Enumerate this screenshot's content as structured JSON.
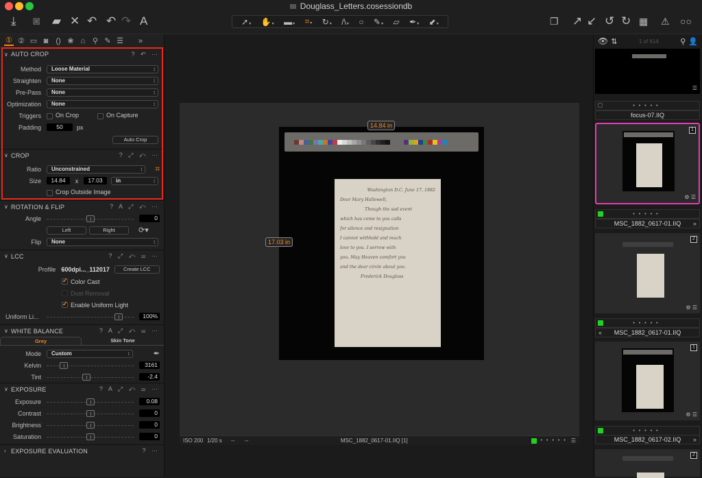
{
  "window": {
    "title": "Douglass_Letters.cosessiondb",
    "traffic_lights": [
      "#fe5f57",
      "#febc2e",
      "#28c840"
    ]
  },
  "toolbar": {
    "left_icons": [
      "import-icon",
      "camera-icon",
      "folder-move-icon",
      "delete-icon",
      "reset-icon",
      "undo-icon",
      "redo-icon",
      "text-icon"
    ],
    "cursor_tools": [
      "select-icon",
      "pan-icon",
      "loupe-icon",
      "crop-icon",
      "rotate-icon",
      "keystone-icon",
      "spot-icon",
      "brush-icon",
      "ruler-icon",
      "picker-icon",
      "annotate-icon"
    ],
    "active_cursor_tool": "crop-icon",
    "right_icons": [
      "multi-view-icon",
      "copy-adjust-icon",
      "apply-adjust-icon",
      "rotate-left-icon",
      "rotate-right-icon",
      "grid-icon",
      "warning-icon",
      "proof-glasses-icon"
    ]
  },
  "tool_tabs": [
    "1",
    "2",
    "folder",
    "camera",
    "lens",
    "color",
    "exposure",
    "details",
    "adjust",
    "metadata",
    "more"
  ],
  "auto_crop": {
    "title": "AUTO CROP",
    "method_label": "Method",
    "method_value": "Loose Material",
    "straighten_label": "Straighten",
    "straighten_value": "None",
    "prepass_label": "Pre-Pass",
    "prepass_value": "None",
    "optimization_label": "Optimization",
    "optimization_value": "None",
    "triggers_label": "Triggers",
    "on_crop_label": "On Crop",
    "on_crop_checked": false,
    "on_capture_label": "On Capture",
    "on_capture_checked": false,
    "padding_label": "Padding",
    "padding_value": "50",
    "padding_unit": "px",
    "button_label": "Auto Crop"
  },
  "crop": {
    "title": "CROP",
    "ratio_label": "Ratio",
    "ratio_value": "Unconstrained",
    "size_label": "Size",
    "width": "14.84",
    "x": "x",
    "height": "17.03",
    "unit": "in",
    "crop_outside_label": "Crop Outside Image",
    "crop_outside_checked": false
  },
  "rotation": {
    "title": "ROTATION & FLIP",
    "angle_label": "Angle",
    "angle_value": "0",
    "angle_slider": 0.5,
    "left_label": "Left",
    "right_label": "Right",
    "flip_label": "Flip",
    "flip_value": "None"
  },
  "lcc": {
    "title": "LCC",
    "profile_label": "Profile",
    "profile_value": "600dpi..._112017",
    "create_label": "Create LCC",
    "color_cast_label": "Color Cast",
    "color_cast_checked": true,
    "dust_label": "Dust Removal",
    "dust_checked": false,
    "uniform_label": "Enable Uniform Light",
    "uniform_checked": true,
    "uniform_slider_label": "Uniform Li...",
    "uniform_slider_value": "100%",
    "uniform_slider": 0.83
  },
  "white_balance": {
    "title": "WHITE BALANCE",
    "tab_grey": "Grey",
    "tab_skin": "Skin Tone",
    "mode_label": "Mode",
    "mode_value": "Custom",
    "kelvin_label": "Kelvin",
    "kelvin_value": "3161",
    "kelvin_slider": 0.2,
    "tint_label": "Tint",
    "tint_value": "-2.4",
    "tint_slider": 0.46
  },
  "exposure": {
    "title": "EXPOSURE",
    "sliders": [
      {
        "label": "Exposure",
        "value": "0.08",
        "pos": 0.5
      },
      {
        "label": "Contrast",
        "value": "0",
        "pos": 0.5
      },
      {
        "label": "Brightness",
        "value": "0",
        "pos": 0.5
      },
      {
        "label": "Saturation",
        "value": "0",
        "pos": 0.5
      }
    ]
  },
  "exposure_evaluation": {
    "title": "EXPOSURE EVALUATION"
  },
  "viewer": {
    "crop_width_label": "14.84 in",
    "crop_height_label": "17.03 in",
    "letter_lines": [
      "Washington D.C. June 17, 1882",
      "Dear Mary Hallowell,",
      "Though the sad event",
      "which has come to you calls",
      "for silence and resignation",
      "I cannot withhold and much",
      "love to you. I sorrow with",
      "you. May Heaven comfort you",
      "and the dear circle about you.",
      "Frederick Douglass"
    ],
    "color_chart": [
      "#6b3a30",
      "#c08a80",
      "#4b5ca0",
      "#3f7a3f",
      "#8a6ab0",
      "#3ab0a8",
      "#d4701c",
      "#3a48a0",
      "#c03a48",
      "#f0f0f0",
      "#d8d8d8",
      "#c0c0c0",
      "#a8a8a8",
      "#909090",
      "#787878",
      "#606060",
      "#484848",
      "#303030",
      "#202020",
      "#151515",
      "#5a2e80",
      "#8ab83a",
      "#e0a018",
      "#283c90",
      "#3a8a3a",
      "#b02830",
      "#e0c818",
      "#b83890",
      "#1a88b8"
    ]
  },
  "statusbar": {
    "iso": "ISO 200",
    "shutter": "1/20 s",
    "aperture": "--",
    "focal": "--",
    "filename": "MSC_1882_0617-01.IIQ [1]"
  },
  "browser": {
    "count": "1 of 614",
    "items": [
      {
        "name": "focus-07.IIQ",
        "badge": "",
        "selected": false,
        "tag": "",
        "arrow": ""
      },
      {
        "name": "MSC_1882_0617-01.IIQ",
        "badge": "1",
        "selected": true,
        "tag": "green",
        "arrow": "right"
      },
      {
        "name": "MSC_1882_0617-01.IIQ",
        "badge": "2",
        "selected": false,
        "tag": "green",
        "arrow": "left"
      },
      {
        "name": "MSC_1882_0617-02.IIQ",
        "badge": "1",
        "selected": false,
        "tag": "green",
        "arrow": "right"
      },
      {
        "name": "",
        "badge": "2",
        "selected": false,
        "tag": "",
        "arrow": ""
      }
    ]
  },
  "colors": {
    "accent": "#f08a24",
    "selection": "#e83cb4",
    "highlight": "#e8281a",
    "tag_green": "#22d222"
  }
}
